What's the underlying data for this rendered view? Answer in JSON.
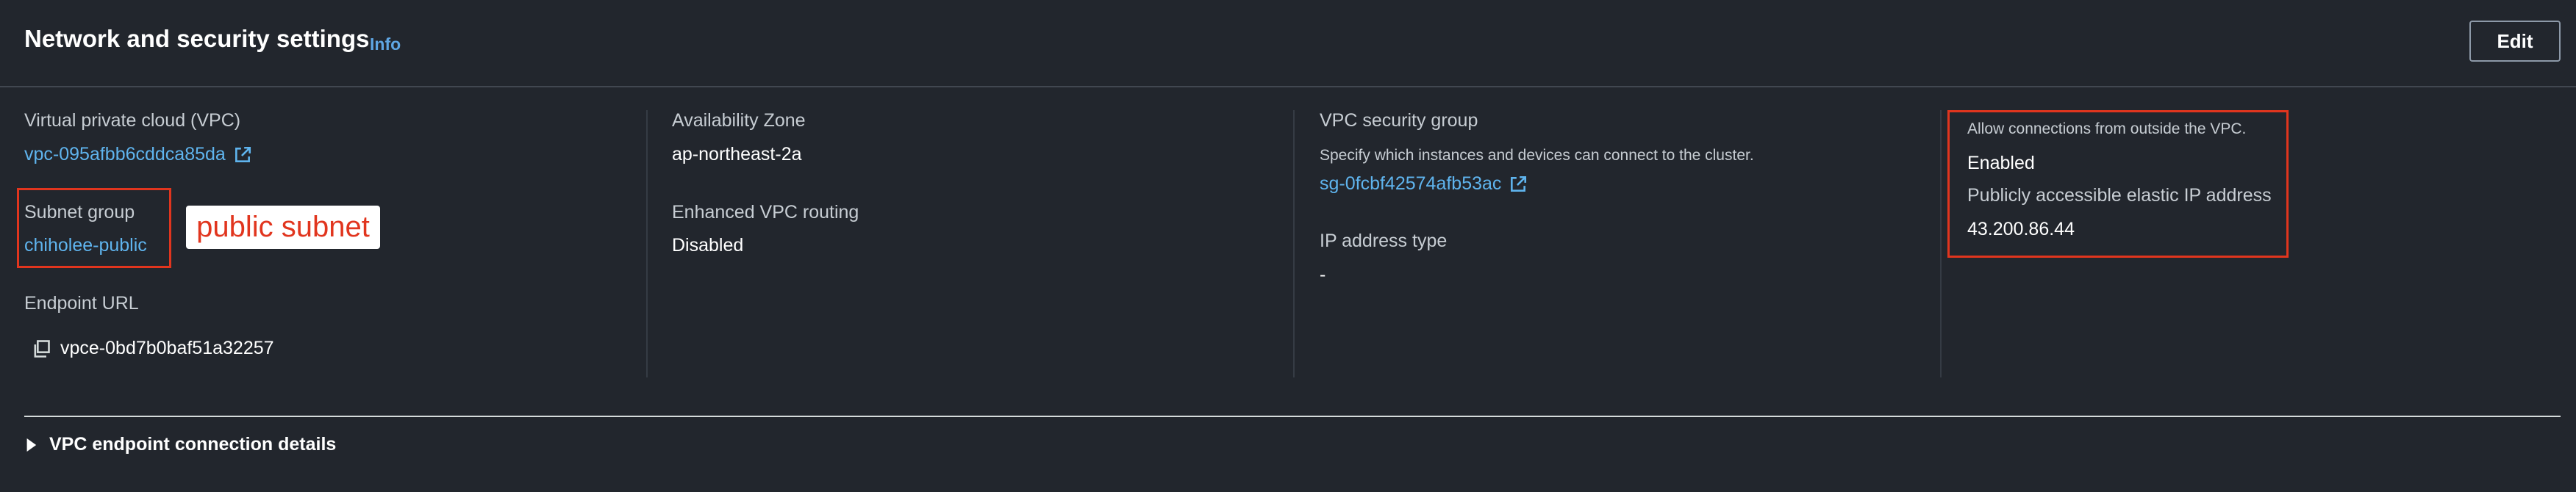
{
  "header": {
    "title": "Network and security settings",
    "info_label": "Info",
    "edit_label": "Edit"
  },
  "vpc": {
    "label": "Virtual private cloud (VPC)",
    "value": "vpc-095afbb6cddca85da"
  },
  "subnet_group": {
    "label": "Subnet group",
    "value": "chiholee-public",
    "annotation": "public subnet"
  },
  "endpoint_url": {
    "label": "Endpoint URL",
    "value": "vpce-0bd7b0baf51a32257"
  },
  "availability_zone": {
    "label": "Availability Zone",
    "value": "ap-northeast-2a"
  },
  "enhanced_vpc_routing": {
    "label": "Enhanced VPC routing",
    "value": "Disabled"
  },
  "vpc_security_group": {
    "label": "VPC security group",
    "description": "Specify which instances and devices can connect to the cluster.",
    "value": "sg-0fcbf42574afb53ac"
  },
  "ip_address_type": {
    "label": "IP address type",
    "value": "-"
  },
  "public_access": {
    "label": "Allow connections from outside the VPC.",
    "value": "Enabled",
    "elastic_ip_label": "Publicly accessible elastic IP address",
    "elastic_ip_value": "43.200.86.44"
  },
  "vpc_endpoint_details": {
    "label": "VPC endpoint connection details"
  },
  "colors": {
    "background": "#22262d",
    "link": "#5fb4ee",
    "annotation_red": "#e1351e"
  },
  "icons": [
    "external-link-icon",
    "copy-icon",
    "caret-right-icon"
  ]
}
